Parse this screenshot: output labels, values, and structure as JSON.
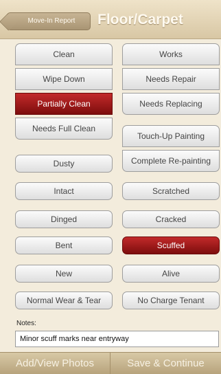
{
  "header": {
    "back_label": "Move-In Report",
    "title": "Floor/Carpet"
  },
  "options": {
    "clean": "Clean",
    "wipe_down": "Wipe Down",
    "partially_clean": "Partially Clean",
    "needs_full_clean": "Needs Full Clean",
    "works": "Works",
    "needs_repair": "Needs Repair",
    "needs_replacing": "Needs Replacing",
    "touch_up_painting": "Touch-Up Painting",
    "complete_repainting": "Complete Re-painting",
    "dusty": "Dusty",
    "intact": "Intact",
    "scratched": "Scratched",
    "dinged": "Dinged",
    "cracked": "Cracked",
    "bent": "Bent",
    "scuffed": "Scuffed",
    "new": "New",
    "alive": "Alive",
    "normal_wear": "Normal Wear & Tear",
    "no_charge": "No Charge Tenant"
  },
  "notes": {
    "label": "Notes:",
    "value": "Minor scuff marks near entryway"
  },
  "footer": {
    "photos_label": "Add/View Photos",
    "save_label": "Save & Continue"
  }
}
